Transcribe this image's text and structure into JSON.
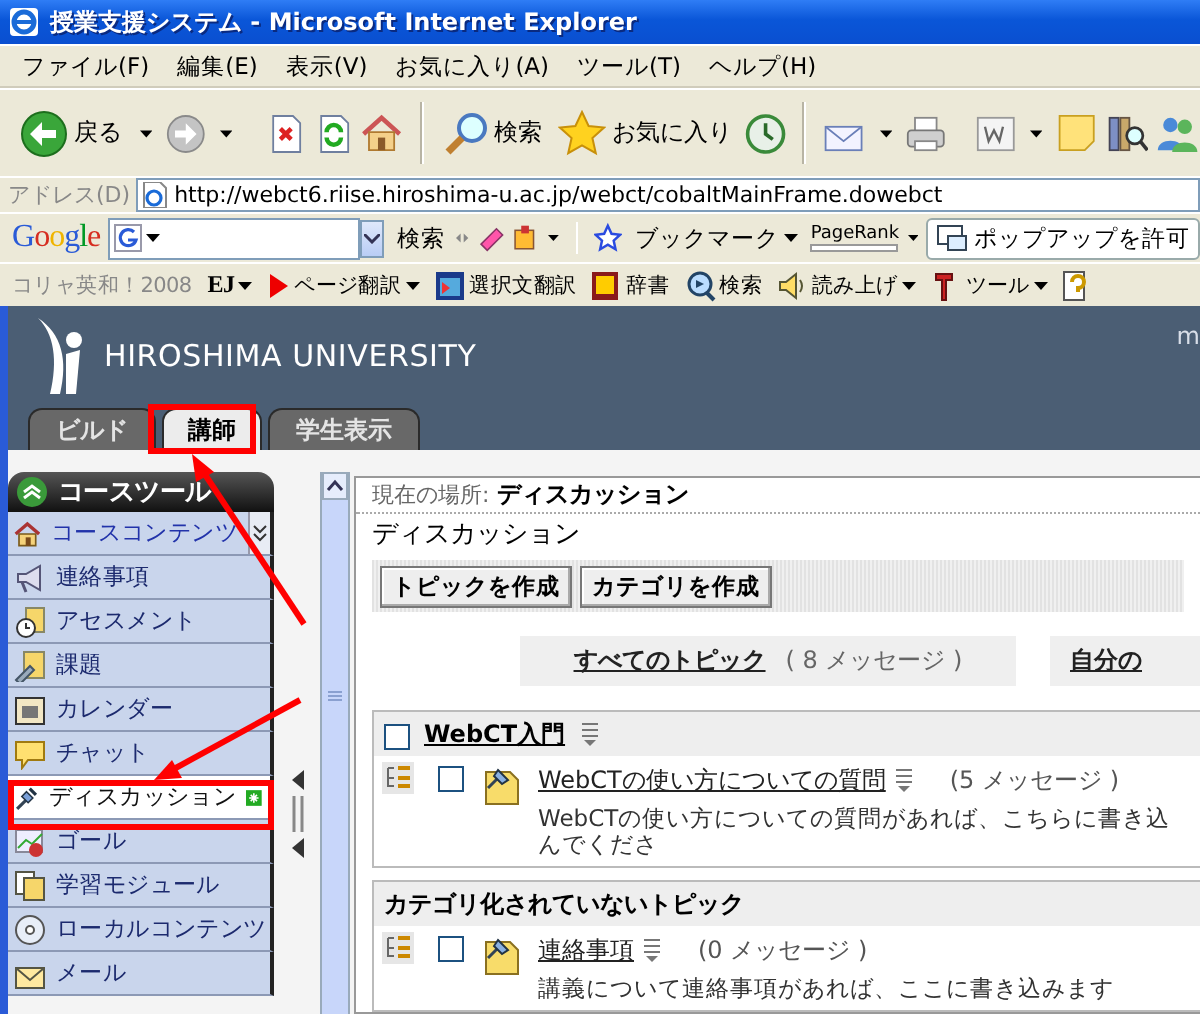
{
  "window": {
    "title": "授業支援システム - Microsoft Internet Explorer"
  },
  "menu": [
    "ファイル(F)",
    "編集(E)",
    "表示(V)",
    "お気に入り(A)",
    "ツール(T)",
    "ヘルプ(H)"
  ],
  "toolbar": {
    "back": "戻る",
    "search": "検索",
    "favorites": "お気に入り"
  },
  "address": {
    "label": "アドレス(D)",
    "url": "http://webct6.riise.hiroshima-u.ac.jp/webct/cobaltMainFrame.dowebct"
  },
  "google_toolbar": {
    "logo": "Google",
    "search_button": "検索",
    "bookmarks": "ブックマーク",
    "pagerank": "PageRank",
    "popup_button": "ポップアップを許可"
  },
  "translate_toolbar": {
    "product": "コリャ英和！2008",
    "mode": "EJ",
    "items": [
      {
        "kind": "page",
        "label": "ページ翻訳",
        "menu": true
      },
      {
        "kind": "selection",
        "label": "選択文翻訳",
        "menu": false
      },
      {
        "kind": "dictionary",
        "label": "辞書",
        "menu": false
      },
      {
        "kind": "search",
        "label": "検索",
        "menu": false
      },
      {
        "kind": "speech",
        "label": "読み上げ",
        "menu": true
      },
      {
        "kind": "tools",
        "label": "ツール",
        "menu": true
      }
    ]
  },
  "site": {
    "logo": "HIROSHIMA UNIVERSITY",
    "corner_text": "m",
    "tabs": [
      {
        "label": "ビルド",
        "selected": false
      },
      {
        "label": "講師",
        "selected": true
      },
      {
        "label": "学生表示",
        "selected": false
      }
    ]
  },
  "sidebar": {
    "title": "コースツール",
    "items": [
      {
        "kind": "home",
        "label": "コースコンテンツ",
        "selected": false,
        "new": false
      },
      {
        "kind": "announcements",
        "label": "連絡事項",
        "selected": false,
        "new": false
      },
      {
        "kind": "assessments",
        "label": "アセスメント",
        "selected": false,
        "new": false
      },
      {
        "kind": "assignments",
        "label": "課題",
        "selected": false,
        "new": false
      },
      {
        "kind": "calendar",
        "label": "カレンダー",
        "selected": false,
        "new": false
      },
      {
        "kind": "chat",
        "label": "チャット",
        "selected": false,
        "new": false
      },
      {
        "kind": "discussions",
        "label": "ディスカッション",
        "selected": true,
        "new": true
      },
      {
        "kind": "goals",
        "label": "ゴール",
        "selected": false,
        "new": false
      },
      {
        "kind": "modules",
        "label": "学習モジュール",
        "selected": false,
        "new": false
      },
      {
        "kind": "local",
        "label": "ローカルコンテンツ",
        "selected": false,
        "new": false
      },
      {
        "kind": "mail",
        "label": "メール",
        "selected": false,
        "new": false
      }
    ]
  },
  "discussion": {
    "location_label": "現在の場所:",
    "location": "ディスカッション",
    "title": "ディスカッション",
    "buttons": [
      "トピックを作成",
      "カテゴリを作成"
    ],
    "views": [
      {
        "label": "すべてのトピック",
        "count": "( 8 メッセージ )"
      },
      {
        "label": "自分の"
      }
    ],
    "categories": [
      {
        "kind": "category",
        "name": "WebCT入門",
        "checked": false,
        "topics": [
          {
            "title": "WebCTの使い方についての質問",
            "count": "(5 メッセージ )",
            "checked": false,
            "description": "WebCTの使い方についての質問があれば、こちらに書き込んでくださ"
          }
        ]
      },
      {
        "kind": "uncategorized",
        "name": "カテゴリ化されていないトピック",
        "topics": [
          {
            "title": "連絡事項",
            "count": "(0 メッセージ )",
            "checked": false,
            "description": "講義について連絡事項があれば、ここに書き込みます"
          }
        ]
      }
    ]
  }
}
